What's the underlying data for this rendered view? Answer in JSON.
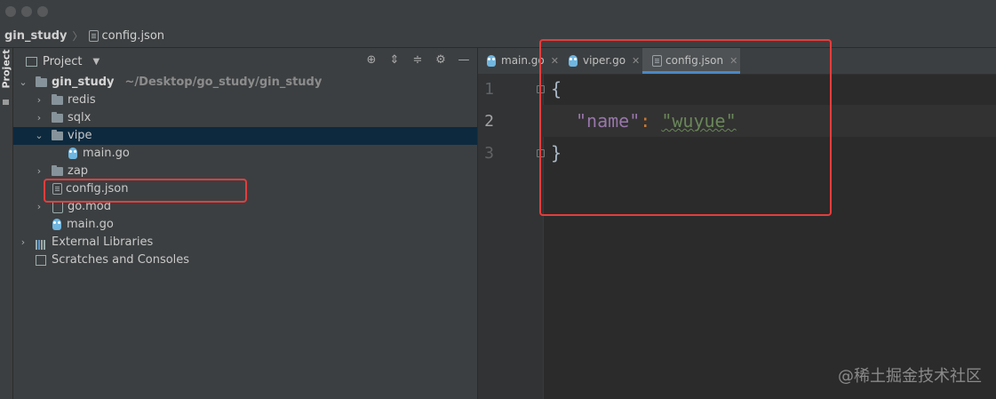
{
  "nav": {
    "project": "gin_study",
    "file": "config.json"
  },
  "sidestrip": {
    "label": "Project"
  },
  "project_panel": {
    "title": "Project"
  },
  "tree": [
    {
      "label": "gin_study",
      "path": "~/Desktop/go_study/gin_study",
      "type": "folder",
      "expanded": true
    },
    {
      "label": "redis",
      "type": "folder",
      "expanded": false
    },
    {
      "label": "sqlx",
      "type": "folder",
      "expanded": false
    },
    {
      "label": "vipe",
      "type": "folder",
      "expanded": true,
      "selected": true
    },
    {
      "label": "main.go",
      "type": "go-file"
    },
    {
      "label": "zap",
      "type": "folder",
      "expanded": false
    },
    {
      "label": "config.json",
      "type": "json-file"
    },
    {
      "label": "go.mod",
      "type": "mod-file",
      "expanded": false
    },
    {
      "label": "main.go",
      "type": "go-file"
    },
    {
      "label": "External Libraries",
      "type": "libraries",
      "expanded": false
    },
    {
      "label": "Scratches and Consoles",
      "type": "scratches"
    }
  ],
  "tabs": [
    {
      "label": "main.go",
      "icon": "gopher-icon"
    },
    {
      "label": "viper.go",
      "icon": "gopher-icon"
    },
    {
      "label": "config.json",
      "icon": "json-file-icon",
      "active": true
    }
  ],
  "editor": {
    "line_numbers": [
      "1",
      "2",
      "3"
    ],
    "lines": {
      "l1": "{",
      "key": "\"name\"",
      "colon": ":",
      "value": "\"wuyue\"",
      "l3": "}"
    }
  },
  "watermark": "@稀土掘金技术社区",
  "colors": {
    "highlight": "#e43d3d",
    "selection": "#0d293e",
    "tab_active": "#4a88c7"
  }
}
